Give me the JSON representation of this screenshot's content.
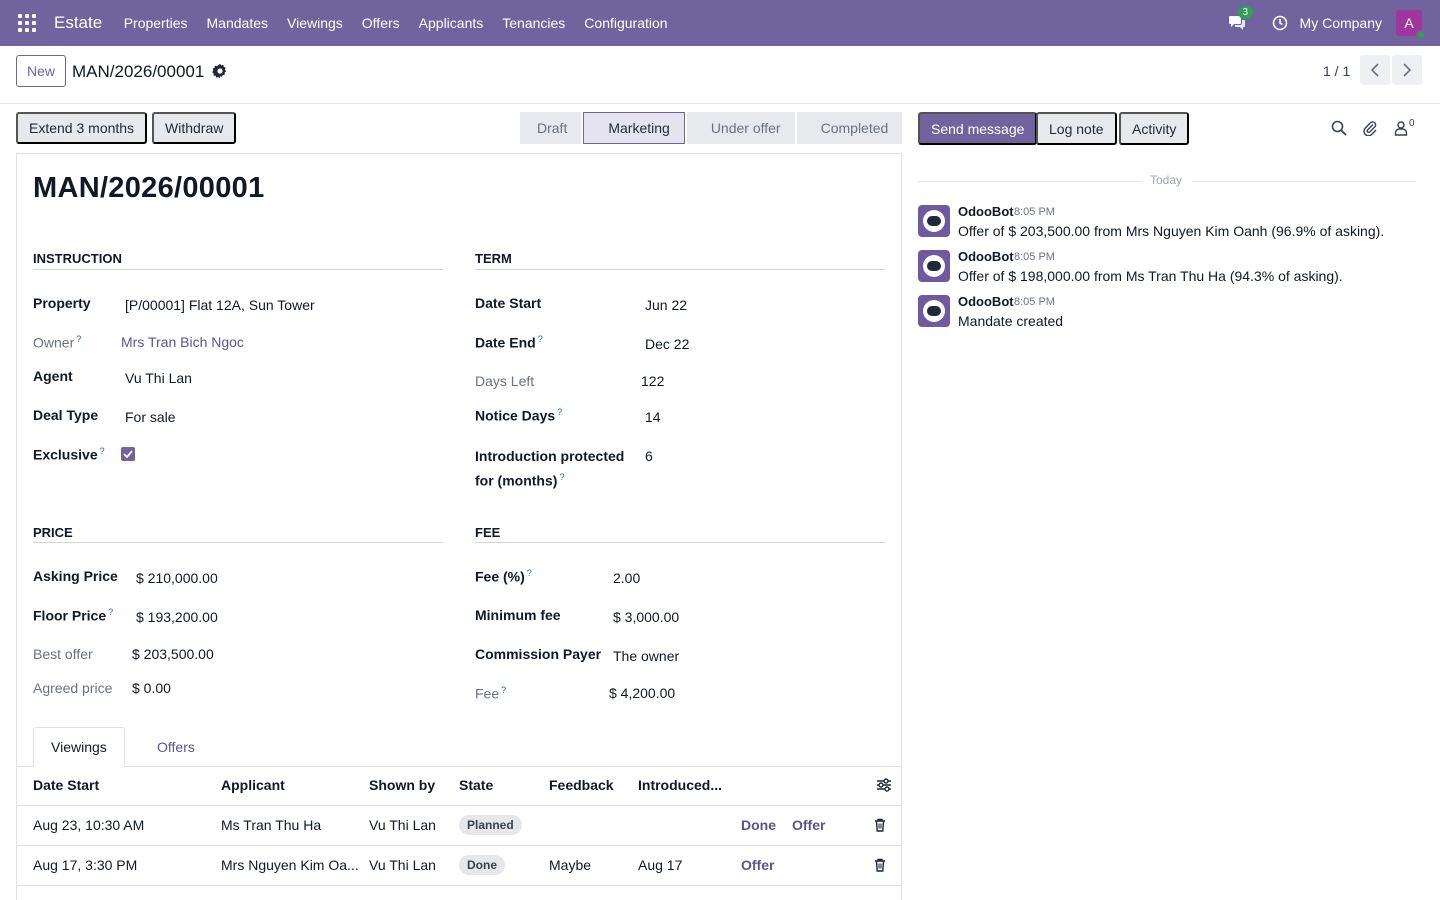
{
  "navbar": {
    "brand": "Estate",
    "menu": [
      "Properties",
      "Mandates",
      "Viewings",
      "Offers",
      "Applicants",
      "Tenancies",
      "Configuration"
    ],
    "message_count": "3",
    "company": "My Company",
    "avatar_letter": "A"
  },
  "control": {
    "new_label": "New",
    "record_name": "MAN/2026/00001",
    "pager": "1 / 1"
  },
  "actions": {
    "extend_label": "Extend 3 months",
    "withdraw_label": "Withdraw"
  },
  "stages": [
    "Draft",
    "Marketing",
    "Under offer",
    "Completed"
  ],
  "active_stage": "Marketing",
  "form": {
    "title": "MAN/2026/00001",
    "instruction": {
      "heading": "Instruction",
      "property_label": "Property",
      "property_value": "[P/00001] Flat 12A, Sun Tower",
      "owner_label": "Owner",
      "owner_value": "Mrs Tran Bich Ngoc",
      "agent_label": "Agent",
      "agent_value": "Vu Thi Lan",
      "deal_type_label": "Deal Type",
      "deal_type_value": "For sale",
      "exclusive_label": "Exclusive",
      "exclusive_checked": true
    },
    "term": {
      "heading": "Term",
      "date_start_label": "Date Start",
      "date_start_value": "Jun 22",
      "date_end_label": "Date End",
      "date_end_value": "Dec 22",
      "days_left_label": "Days Left",
      "days_left_value": "122",
      "notice_days_label": "Notice Days",
      "notice_days_value": "14",
      "intro_label_line1": "Introduction protected",
      "intro_label_line2": "for (months)",
      "intro_value": "6"
    },
    "price": {
      "heading": "Price",
      "asking_label": "Asking Price",
      "asking_value": "$ 210,000.00",
      "floor_label": "Floor Price",
      "floor_value": "$ 193,200.00",
      "best_label": "Best offer",
      "best_value": "$ 203,500.00",
      "agreed_label": "Agreed price",
      "agreed_value": "$ 0.00"
    },
    "fee": {
      "heading": "Fee",
      "fee_pct_label": "Fee (%)",
      "fee_pct_value": "2.00",
      "min_fee_label": "Minimum fee",
      "min_fee_value": "$ 3,000.00",
      "payer_label": "Commission Payer",
      "payer_value": "The owner",
      "fee_label": "Fee",
      "fee_value": "$ 4,200.00"
    }
  },
  "tabs": [
    "Viewings",
    "Offers"
  ],
  "viewings": {
    "headers": [
      "Date Start",
      "Applicant",
      "Shown by",
      "State",
      "Feedback",
      "Introduced..."
    ],
    "rows": [
      {
        "date": "Aug 23, 10:30 AM",
        "applicant": "Ms Tran Thu Ha",
        "shown_by": "Vu Thi Lan",
        "state": "Planned",
        "feedback": "",
        "introduced": "",
        "btn1": "Done",
        "btn2": "Offer"
      },
      {
        "date": "Aug 17, 3:30 PM",
        "applicant": "Mrs Nguyen Kim Oa...",
        "shown_by": "Vu Thi Lan",
        "state": "Done",
        "feedback": "Maybe",
        "introduced": "Aug 17",
        "btn1": "Offer",
        "btn2": ""
      }
    ]
  },
  "chatter": {
    "send_label": "Send message",
    "log_label": "Log note",
    "activity_label": "Activity",
    "follower_count": "0",
    "today_label": "Today",
    "messages": [
      {
        "author": "OdooBot",
        "time": "8:05 PM",
        "body": "Offer of $ 203,500.00 from Mrs Nguyen Kim Oanh (96.9% of asking)."
      },
      {
        "author": "OdooBot",
        "time": "8:05 PM",
        "body": "Offer of $ 198,000.00 from Ms Tran Thu Ha (94.3% of asking)."
      },
      {
        "author": "OdooBot",
        "time": "8:05 PM",
        "body": "Mandate created"
      }
    ]
  },
  "colors": {
    "brand": "#71639e",
    "link": "#5b5395",
    "online": "#28a745",
    "badge": "#2fa152"
  }
}
